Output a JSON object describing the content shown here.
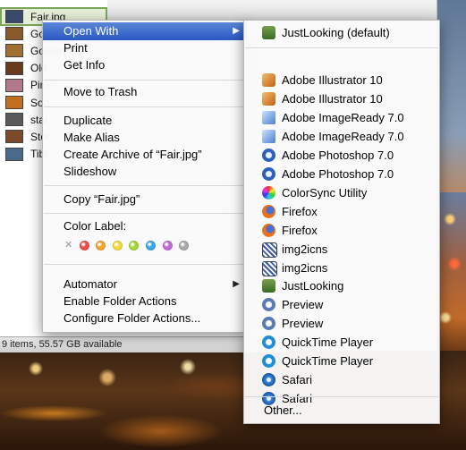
{
  "finder": {
    "files": [
      {
        "name": "Fair.jpg",
        "selected": true,
        "thumb": "#3a4a6a"
      },
      {
        "name": "Gol",
        "selected": false,
        "thumb": "#8a5a2a"
      },
      {
        "name": "Golden",
        "selected": false,
        "thumb": "#a07030"
      },
      {
        "name": "Old",
        "selected": false,
        "thumb": "#6a3a1a"
      },
      {
        "name": "Pink",
        "selected": false,
        "thumb": "#b07a8a"
      },
      {
        "name": "Son",
        "selected": false,
        "thumb": "#c07020"
      },
      {
        "name": "stat",
        "selected": false,
        "thumb": "#5a5a5a"
      },
      {
        "name": "Stor",
        "selected": false,
        "thumb": "#7a4a2a"
      },
      {
        "name": "Tibr",
        "selected": false,
        "thumb": "#4a6a8a"
      }
    ],
    "status": "9 items, 55.57 GB available"
  },
  "context_menu": {
    "open_with": "Open With",
    "print": "Print",
    "get_info": "Get Info",
    "move_to_trash": "Move to Trash",
    "duplicate": "Duplicate",
    "make_alias": "Make Alias",
    "create_archive": "Create Archive of “Fair.jpg”",
    "slideshow": "Slideshow",
    "copy": "Copy “Fair.jpg”",
    "color_label": "Color Label:",
    "label_colors": [
      "#f04b4b",
      "#f6a431",
      "#f2dc3a",
      "#a6d63a",
      "#3aa8e8",
      "#c46ad8",
      "#a8a8a8"
    ],
    "automator": "Automator",
    "enable_folder_actions": "Enable Folder Actions",
    "configure_folder_actions": "Configure Folder Actions..."
  },
  "open_with_menu": {
    "default_app": "JustLooking (default)",
    "apps": [
      {
        "label": "Adobe Illustrator 10",
        "icon": "ai"
      },
      {
        "label": "Adobe Illustrator 10",
        "icon": "ai"
      },
      {
        "label": "Adobe ImageReady 7.0",
        "icon": "ir"
      },
      {
        "label": "Adobe ImageReady 7.0",
        "icon": "ir"
      },
      {
        "label": "Adobe Photoshop 7.0",
        "icon": "ps"
      },
      {
        "label": "Adobe Photoshop 7.0",
        "icon": "ps"
      },
      {
        "label": "ColorSync Utility",
        "icon": "cs"
      },
      {
        "label": "Firefox",
        "icon": "ff"
      },
      {
        "label": "Firefox",
        "icon": "ff"
      },
      {
        "label": "img2icns",
        "icon": "ic2"
      },
      {
        "label": "img2icns",
        "icon": "ic2"
      },
      {
        "label": "JustLooking",
        "icon": "jl"
      },
      {
        "label": "Preview",
        "icon": "pv"
      },
      {
        "label": "Preview",
        "icon": "pv"
      },
      {
        "label": "QuickTime Player",
        "icon": "qt"
      },
      {
        "label": "QuickTime Player",
        "icon": "qt"
      },
      {
        "label": "Safari",
        "icon": "sf"
      },
      {
        "label": "Safari",
        "icon": "sf"
      }
    ],
    "other": "Other..."
  }
}
